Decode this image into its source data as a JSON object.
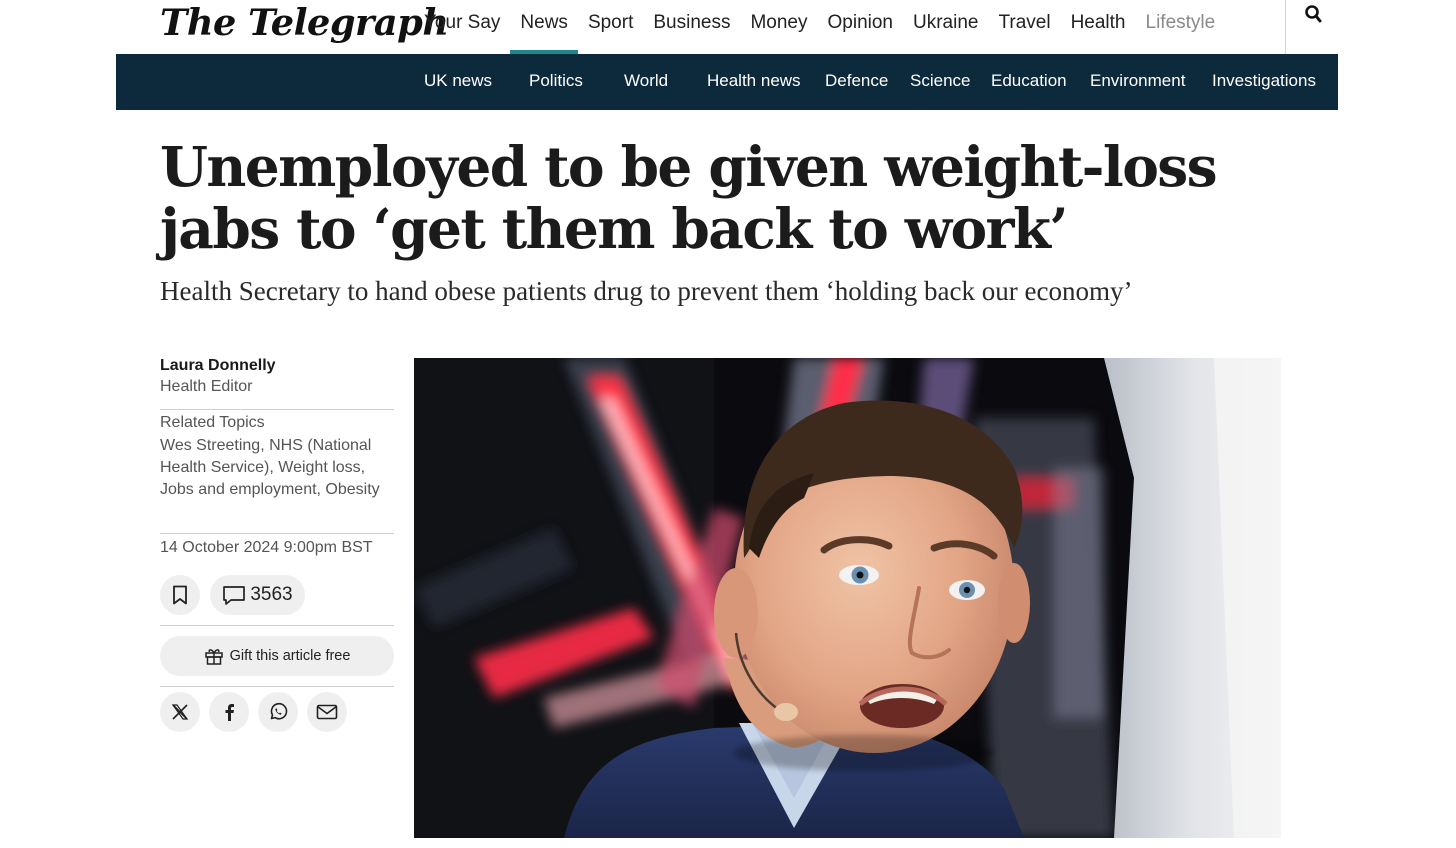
{
  "brand": {
    "logo_text": "The Telegraph"
  },
  "primary_nav": [
    {
      "label": "Your Say"
    },
    {
      "label": "News",
      "active": true
    },
    {
      "label": "Sport"
    },
    {
      "label": "Business"
    },
    {
      "label": "Money"
    },
    {
      "label": "Opinion"
    },
    {
      "label": "Ukraine"
    },
    {
      "label": "Travel"
    },
    {
      "label": "Health"
    },
    {
      "label": "Lifestyle"
    }
  ],
  "search": {
    "icon": "search-icon"
  },
  "secondary_nav": [
    {
      "label": "UK news"
    },
    {
      "label": "Politics"
    },
    {
      "label": "World"
    },
    {
      "label": "Health news"
    },
    {
      "label": "Defence"
    },
    {
      "label": "Science"
    },
    {
      "label": "Education"
    },
    {
      "label": "Environment"
    },
    {
      "label": "Investigations"
    }
  ],
  "article": {
    "headline": "Unemployed to be given weight-loss jabs to ‘get them back to work’",
    "standfirst": "Health Secretary to hand obese patients drug to prevent them ‘holding back our economy’",
    "author": {
      "name": "Laura Donnelly",
      "role": "Health Editor"
    },
    "related_topics_title": "Related Topics",
    "related_topics": [
      "Wes Streeting",
      "NHS (National Health Service)",
      "Weight loss",
      "Jobs and employment",
      "Obesity"
    ],
    "date": "14 October 2024 9:00pm BST",
    "comment_count": "3563",
    "gift_label": "Gift this article free",
    "share": [
      "x-icon",
      "facebook-icon",
      "whatsapp-icon",
      "email-icon"
    ]
  },
  "colors": {
    "subnav_bg": "#0d2a3d",
    "active_underline": "#1a8a8a",
    "pill_bg": "#efefef"
  }
}
